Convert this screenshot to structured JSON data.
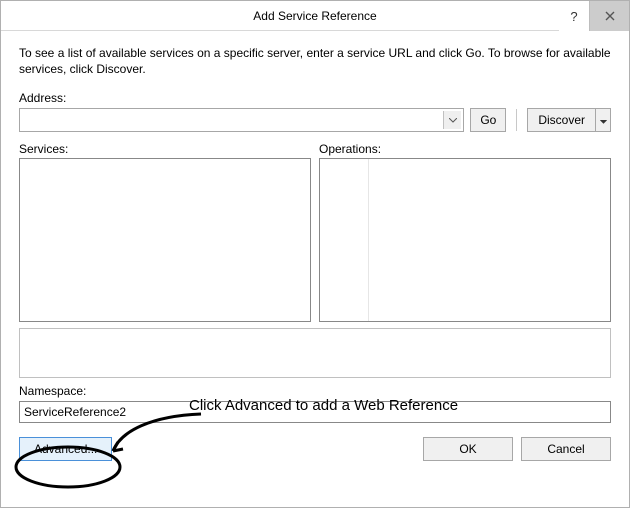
{
  "title": "Add Service Reference",
  "instructions": "To see a list of available services on a specific server, enter a service URL and click Go. To browse for available services, click Discover.",
  "address": {
    "label": "Address:",
    "value": "",
    "go_label": "Go",
    "discover_label": "Discover"
  },
  "columns": {
    "services_label": "Services:",
    "operations_label": "Operations:"
  },
  "namespace": {
    "label": "Namespace:",
    "value": "ServiceReference2"
  },
  "buttons": {
    "advanced": "Advanced...",
    "ok": "OK",
    "cancel": "Cancel"
  },
  "annotation": {
    "text": "Click Advanced to add a Web Reference"
  }
}
